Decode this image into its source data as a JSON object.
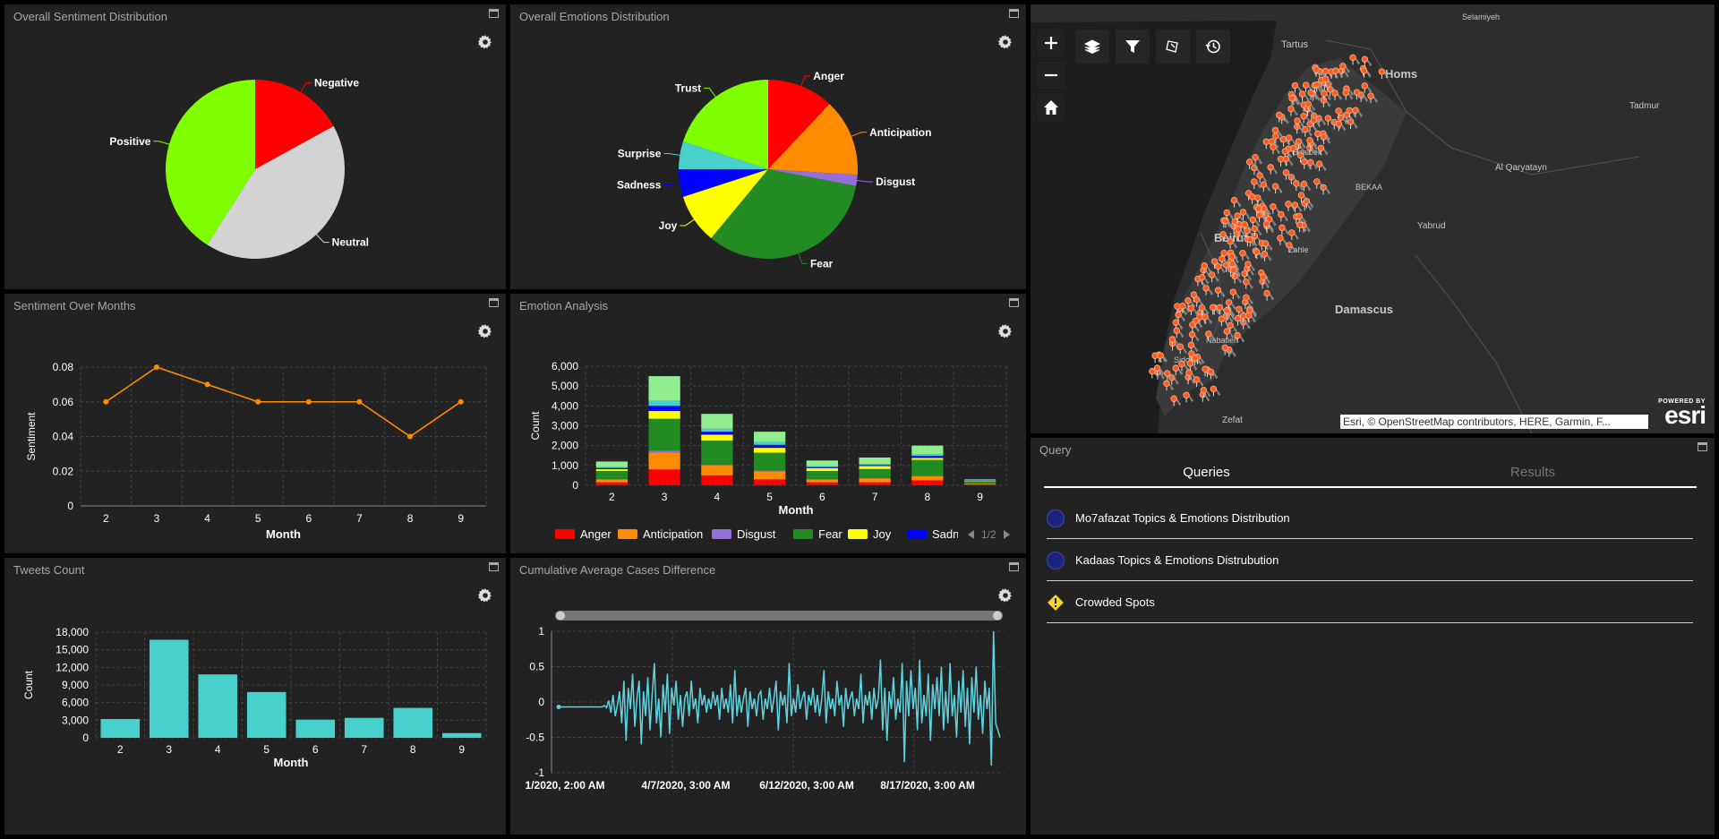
{
  "panels": {
    "sentiment_dist": {
      "title": "Overall Sentiment Distribution"
    },
    "emotions_dist": {
      "title": "Overall Emotions Distribution"
    },
    "sentiment_months": {
      "title": "Sentiment Over Months"
    },
    "emotion_analysis": {
      "title": "Emotion Analysis"
    },
    "tweets_count": {
      "title": "Tweets Count"
    },
    "cumulative": {
      "title": "Cumulative Average Cases Difference"
    }
  },
  "chart_data": [
    {
      "id": "sentiment_pie",
      "type": "pie",
      "title": "Overall Sentiment Distribution",
      "labels": [
        "Negative",
        "Neutral",
        "Positive"
      ],
      "values": [
        17,
        42,
        41
      ],
      "colors": [
        "#ff0000",
        "#d3d3d3",
        "#7fff00"
      ]
    },
    {
      "id": "emotions_pie",
      "type": "pie",
      "title": "Overall Emotions Distribution",
      "labels": [
        "Anger",
        "Anticipation",
        "Disgust",
        "Fear",
        "Joy",
        "Sadness",
        "Surprise",
        "Trust"
      ],
      "values": [
        12,
        14,
        2,
        33,
        9,
        5,
        5,
        20
      ],
      "colors": [
        "#ff0000",
        "#ff8c00",
        "#9370db",
        "#228b22",
        "#ffff00",
        "#0000ff",
        "#48d1cc",
        "#7fff00"
      ]
    },
    {
      "id": "sentiment_line",
      "type": "line",
      "title": "Sentiment Over Months",
      "xlabel": "Month",
      "ylabel": "Sentiment",
      "categories": [
        "2",
        "3",
        "4",
        "5",
        "6",
        "7",
        "8",
        "9"
      ],
      "values": [
        0.06,
        0.08,
        0.07,
        0.06,
        0.06,
        0.06,
        0.04,
        0.06
      ],
      "ylim": [
        0,
        0.08
      ],
      "yticks": [
        "0",
        "0.02",
        "0.04",
        "0.06",
        "0.08"
      ],
      "color": "#ff8c00",
      "grid": true
    },
    {
      "id": "emotion_bars",
      "type": "bar",
      "stacked": true,
      "title": "Emotion Analysis",
      "xlabel": "Month",
      "ylabel": "Count",
      "categories": [
        "2",
        "3",
        "4",
        "5",
        "6",
        "7",
        "8",
        "9"
      ],
      "ylim": [
        0,
        6000
      ],
      "yticks": [
        "0",
        "1,000",
        "2,000",
        "3,000",
        "4,000",
        "5,000",
        "6,000"
      ],
      "series": [
        {
          "name": "Anger",
          "color": "#ff0000",
          "values": [
            150,
            800,
            500,
            300,
            150,
            150,
            250,
            40
          ]
        },
        {
          "name": "Anticipation",
          "color": "#ff8c00",
          "values": [
            150,
            850,
            500,
            400,
            150,
            200,
            200,
            40
          ]
        },
        {
          "name": "Disgust",
          "color": "#9370db",
          "values": [
            20,
            100,
            50,
            40,
            20,
            20,
            30,
            5
          ]
        },
        {
          "name": "Fear",
          "color": "#228b22",
          "values": [
            400,
            1600,
            1200,
            900,
            400,
            450,
            800,
            120
          ]
        },
        {
          "name": "Joy",
          "color": "#ffff00",
          "values": [
            100,
            400,
            300,
            250,
            150,
            150,
            100,
            30
          ]
        },
        {
          "name": "Sadness",
          "color": "#0000ff",
          "values": [
            50,
            250,
            150,
            150,
            50,
            50,
            100,
            10
          ]
        },
        {
          "name": "Surprise",
          "color": "#48d1cc",
          "values": [
            50,
            250,
            150,
            150,
            50,
            50,
            100,
            10
          ]
        },
        {
          "name": "Trust",
          "color": "#90ee90",
          "values": [
            280,
            1250,
            750,
            510,
            280,
            330,
            420,
            45
          ]
        }
      ],
      "legend": {
        "visible": [
          "Anger",
          "Anticipation",
          "Disgust",
          "Fear",
          "Joy",
          "Sadn"
        ],
        "page": "1/2",
        "placement": "bottom"
      }
    },
    {
      "id": "tweets_bars",
      "type": "bar",
      "title": "Tweets Count",
      "xlabel": "Month",
      "ylabel": "Count",
      "categories": [
        "2",
        "3",
        "4",
        "5",
        "6",
        "7",
        "8",
        "9"
      ],
      "values": [
        3200,
        16700,
        10800,
        7800,
        3100,
        3400,
        5100,
        800
      ],
      "ylim": [
        0,
        18000
      ],
      "yticks": [
        "0",
        "3,000",
        "6,000",
        "9,000",
        "12,000",
        "15,000",
        "18,000"
      ],
      "color": "#48d1cc",
      "grid": true
    },
    {
      "id": "cumulative_line",
      "type": "line",
      "title": "Cumulative Average Cases Difference",
      "ylim": [
        -1,
        1
      ],
      "yticks": [
        "1",
        "0.5",
        "0",
        "-0.5",
        "-1"
      ],
      "xticks": [
        "1/2020, 2:00 AM",
        "4/7/2020, 3:00 AM",
        "6/12/2020, 3:00 AM",
        "8/17/2020, 3:00 AM"
      ],
      "color": "#5ed3e0",
      "values": [
        -0.07,
        -0.07,
        -0.07,
        -0.07,
        -0.07,
        -0.07,
        -0.07,
        -0.07,
        -0.07,
        -0.07,
        -0.07,
        -0.07,
        -0.07,
        -0.07,
        -0.07,
        -0.07,
        -0.07,
        -0.07,
        -0.07,
        -0.07,
        -0.07,
        -0.05,
        -0.08,
        0.02,
        -0.15,
        0.1,
        -0.2,
        -0.05,
        0.15,
        -0.3,
        0.3,
        -0.55,
        0.2,
        -0.1,
        0.4,
        -0.35,
        0.05,
        0.3,
        -0.6,
        0.15,
        -0.2,
        0.35,
        -0.4,
        0.1,
        0.55,
        -0.3,
        0.05,
        -0.5,
        0.25,
        -0.15,
        0.4,
        -0.45,
        0.2,
        -0.05,
        0.3,
        -0.25,
        0.1,
        -0.35,
        0.05,
        0.15,
        -0.2,
        0.3,
        -0.1,
        0.05,
        -0.3,
        0.2,
        -0.05,
        0.1,
        -0.15,
        0.05,
        -0.1,
        0.15,
        -0.05,
        0.1,
        -0.25,
        0.2,
        -0.1,
        0.05,
        -0.15,
        0.25,
        -0.3,
        0.45,
        -0.2,
        0.1,
        -0.15,
        0.05,
        0.2,
        -0.35,
        0.15,
        -0.1,
        0.05,
        -0.2,
        0.1,
        0.15,
        -0.25,
        0.05,
        -0.1,
        0.2,
        -0.15,
        0.05,
        0.3,
        -0.4,
        0.15,
        -0.05,
        0.1,
        -0.3,
        0.55,
        -0.2,
        0.05,
        -0.15,
        0.25,
        -0.1,
        0.05,
        0.15,
        -0.25,
        0.1,
        -0.05,
        0.2,
        -0.15,
        0.1,
        -0.2,
        0.05,
        0.45,
        -0.3,
        0.15,
        -0.1,
        0.05,
        -0.2,
        0.3,
        -0.05,
        0.1,
        -0.35,
        0.2,
        -0.1,
        0.05,
        0.15,
        -0.2,
        0.05,
        -0.1,
        0.4,
        -0.3,
        0.1,
        -0.05,
        0.15,
        -0.25,
        0.2,
        -0.1,
        0.05,
        0.6,
        -0.4,
        0.2,
        -0.55,
        0.15,
        -0.1,
        0.35,
        -0.25,
        0.05,
        -0.15,
        0.55,
        -0.85,
        0.3,
        -0.2,
        0.45,
        -0.1,
        0.2,
        -0.4,
        0.6,
        -0.3,
        0.1,
        -0.2,
        0.4,
        -0.55,
        0.25,
        -0.1,
        0.35,
        -0.2,
        0.5,
        -0.4,
        0.15,
        -0.3,
        0.55,
        -0.2,
        0.1,
        -0.5,
        0.3,
        -0.15,
        0.45,
        -0.35,
        0.2,
        -0.6,
        0.35,
        -0.15,
        0.5,
        -0.25,
        0.1,
        -0.45,
        0.3,
        -0.1,
        0.2,
        -0.9,
        1.0,
        -0.3,
        -0.4,
        -0.5
      ]
    }
  ],
  "map": {
    "places": [
      "Selamiyeh",
      "Tartus",
      "Homs",
      "Tadmur",
      "Al Qaryatayn",
      "Yabrud",
      "Beirut",
      "Damascus",
      "Zefat",
      "Sidon",
      "Nabatieh",
      "BEKAA",
      "Zahle",
      "Baalbek"
    ],
    "attribution": "Esri, © OpenStreetMap contributors, HERE, Garmin, F...",
    "logo_small": "POWERED BY",
    "logo": "esri",
    "tools": [
      "zoom-in",
      "zoom-out",
      "home",
      "layers",
      "filter",
      "select",
      "history"
    ]
  },
  "query": {
    "title": "Query",
    "tabs": [
      "Queries",
      "Results"
    ],
    "active_tab": "Queries",
    "items": [
      {
        "label": "Mo7afazat Topics & Emotions Distribution",
        "icon": "circle-icon",
        "color": "#1a237e"
      },
      {
        "label": "Kadaas Topics & Emotions Distrubution",
        "icon": "circle-icon",
        "color": "#1a237e"
      },
      {
        "label": "Crowded Spots",
        "icon": "warning-diamond-icon",
        "color": "#f5d42a"
      }
    ]
  }
}
